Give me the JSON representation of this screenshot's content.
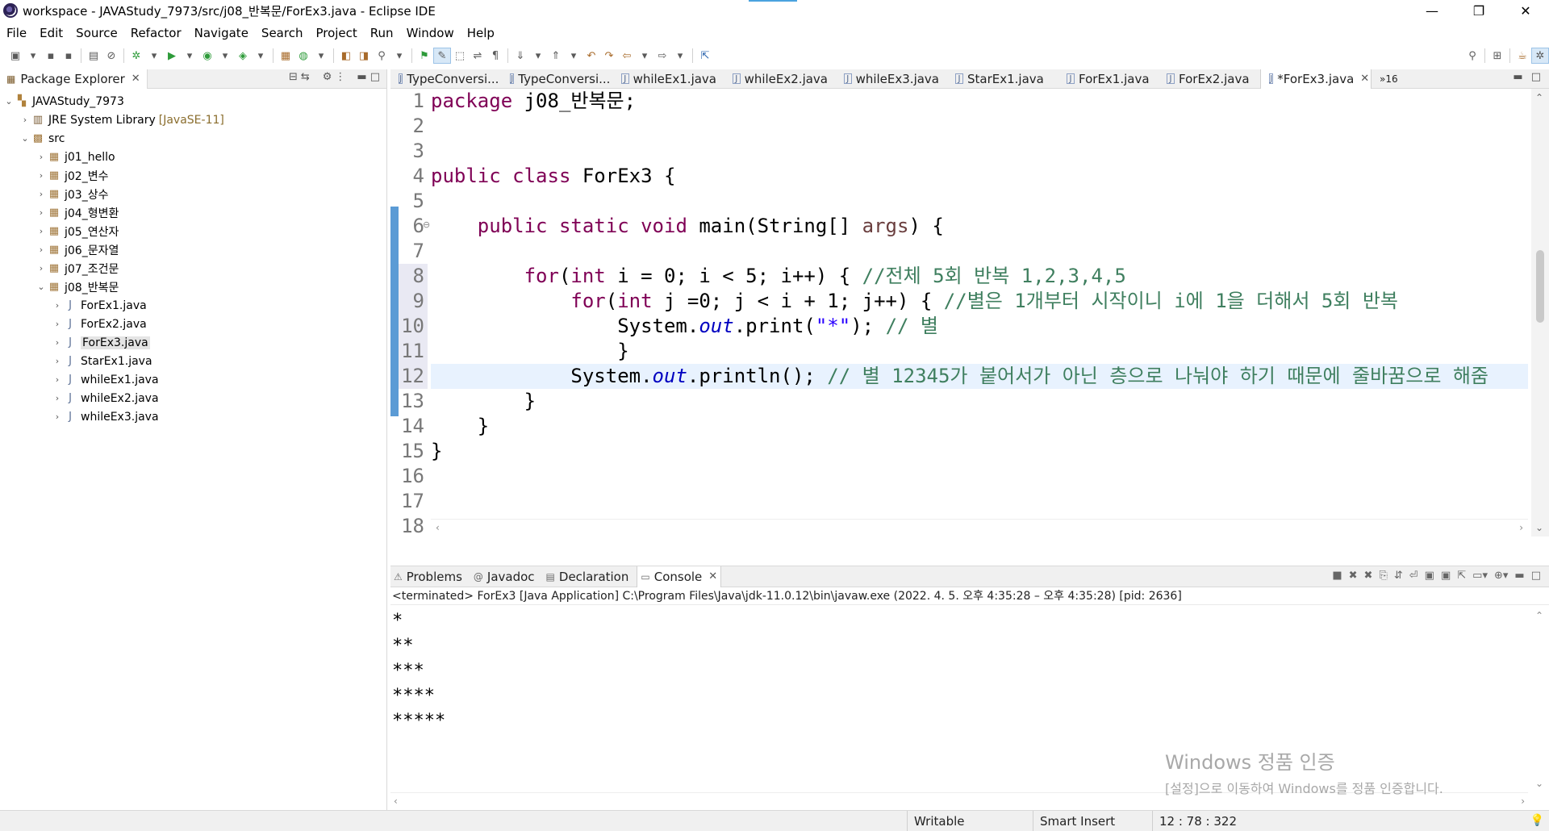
{
  "window": {
    "title": "workspace - JAVAStudy_7973/src/j08_반복문/ForEx3.java - Eclipse IDE",
    "minimize": "—",
    "restore": "❐",
    "close": "✕"
  },
  "menu": [
    "File",
    "Edit",
    "Source",
    "Refactor",
    "Navigate",
    "Search",
    "Project",
    "Run",
    "Window",
    "Help"
  ],
  "package_explorer": {
    "tab_label": "Package Explorer",
    "close": "✕",
    "project": "JAVAStudy_7973",
    "jre_label": "JRE System Library",
    "jre_version": "[JavaSE-11]",
    "src": "src",
    "packages": [
      "j01_hello",
      "j02_변수",
      "j03_상수",
      "j04_형변환",
      "j05_연산자",
      "j06_문자열",
      "j07_조건문",
      "j08_반복문"
    ],
    "files": [
      "ForEx1.java",
      "ForEx2.java",
      "ForEx3.java",
      "StarEx1.java",
      "whileEx1.java",
      "whileEx2.java",
      "whileEx3.java"
    ],
    "selected_file": "ForEx3.java"
  },
  "editor": {
    "tabs": [
      "TypeConversi...",
      "TypeConversi...",
      "whileEx1.java",
      "whileEx2.java",
      "whileEx3.java",
      "StarEx1.java",
      "ForEx1.java",
      "ForEx2.java",
      "*ForEx3.java"
    ],
    "active_tab": "*ForEx3.java",
    "overflow": "»16",
    "line_numbers": [
      "1",
      "2",
      "3",
      "4",
      "5",
      "6",
      "7",
      "8",
      "9",
      "10",
      "11",
      "12",
      "13",
      "14",
      "15",
      "16",
      "17",
      "18"
    ],
    "code": {
      "l1_kw": "package",
      "l1_rest": " j08_반복문;",
      "l4_kw1": "public",
      "l4_kw2": "class",
      "l4_rest": " ForEx3 {",
      "l6_indent": "    ",
      "l6_kw1": "public",
      "l6_kw2": "static",
      "l6_kw3": "void",
      "l6_mid": " main(String[] ",
      "l6_arg": "args",
      "l6_end": ") {",
      "l8_indent": "        ",
      "l8_kw1": "for",
      "l8_a": "(",
      "l8_kw2": "int",
      "l8_b": " i = 0; i < 5; i++) { ",
      "l8_cm": "//전체 5회 반복 1,2,3,4,5",
      "l9_indent": "            ",
      "l9_kw1": "for",
      "l9_a": "(",
      "l9_kw2": "int",
      "l9_b": " j =0; j < i + 1; j++) { ",
      "l9_cm": "//별은 1개부터 시작이니 i에 1을 더해서 5회 반복",
      "l10_indent": "                ",
      "l10_a": "System.",
      "l10_fi": "out",
      "l10_b": ".print(",
      "l10_st": "\"*\"",
      "l10_c": "); ",
      "l10_cm": "// 별",
      "l11": "                }",
      "l12_indent": "            ",
      "l12_a": "System.",
      "l12_fi": "out",
      "l12_b": ".println(); ",
      "l12_cm": "// 별 12345가 붙어서가 아닌 층으로 나눠야 하기 때문에 줄바꿈으로 해줌",
      "l13": "        }",
      "l14": "    }",
      "l15": "}"
    }
  },
  "console": {
    "tabs": {
      "problems": "Problems",
      "javadoc": "Javadoc",
      "declaration": "Declaration",
      "console": "Console"
    },
    "close": "✕",
    "status": "<terminated> ForEx3 [Java Application] C:\\Program Files\\Java\\jdk-11.0.12\\bin\\javaw.exe  (2022. 4. 5. 오후 4:35:28 – 오후 4:35:28) [pid: 2636]",
    "output": [
      "*",
      "**",
      "***",
      "****",
      "*****"
    ]
  },
  "watermark": {
    "line1": "Windows 정품 인증",
    "line2": "[설정]으로 이동하여 Windows를 정품 인증합니다."
  },
  "statusbar": {
    "writable": "Writable",
    "insert_mode": "Smart Insert",
    "position": "12 : 78 : 322"
  }
}
